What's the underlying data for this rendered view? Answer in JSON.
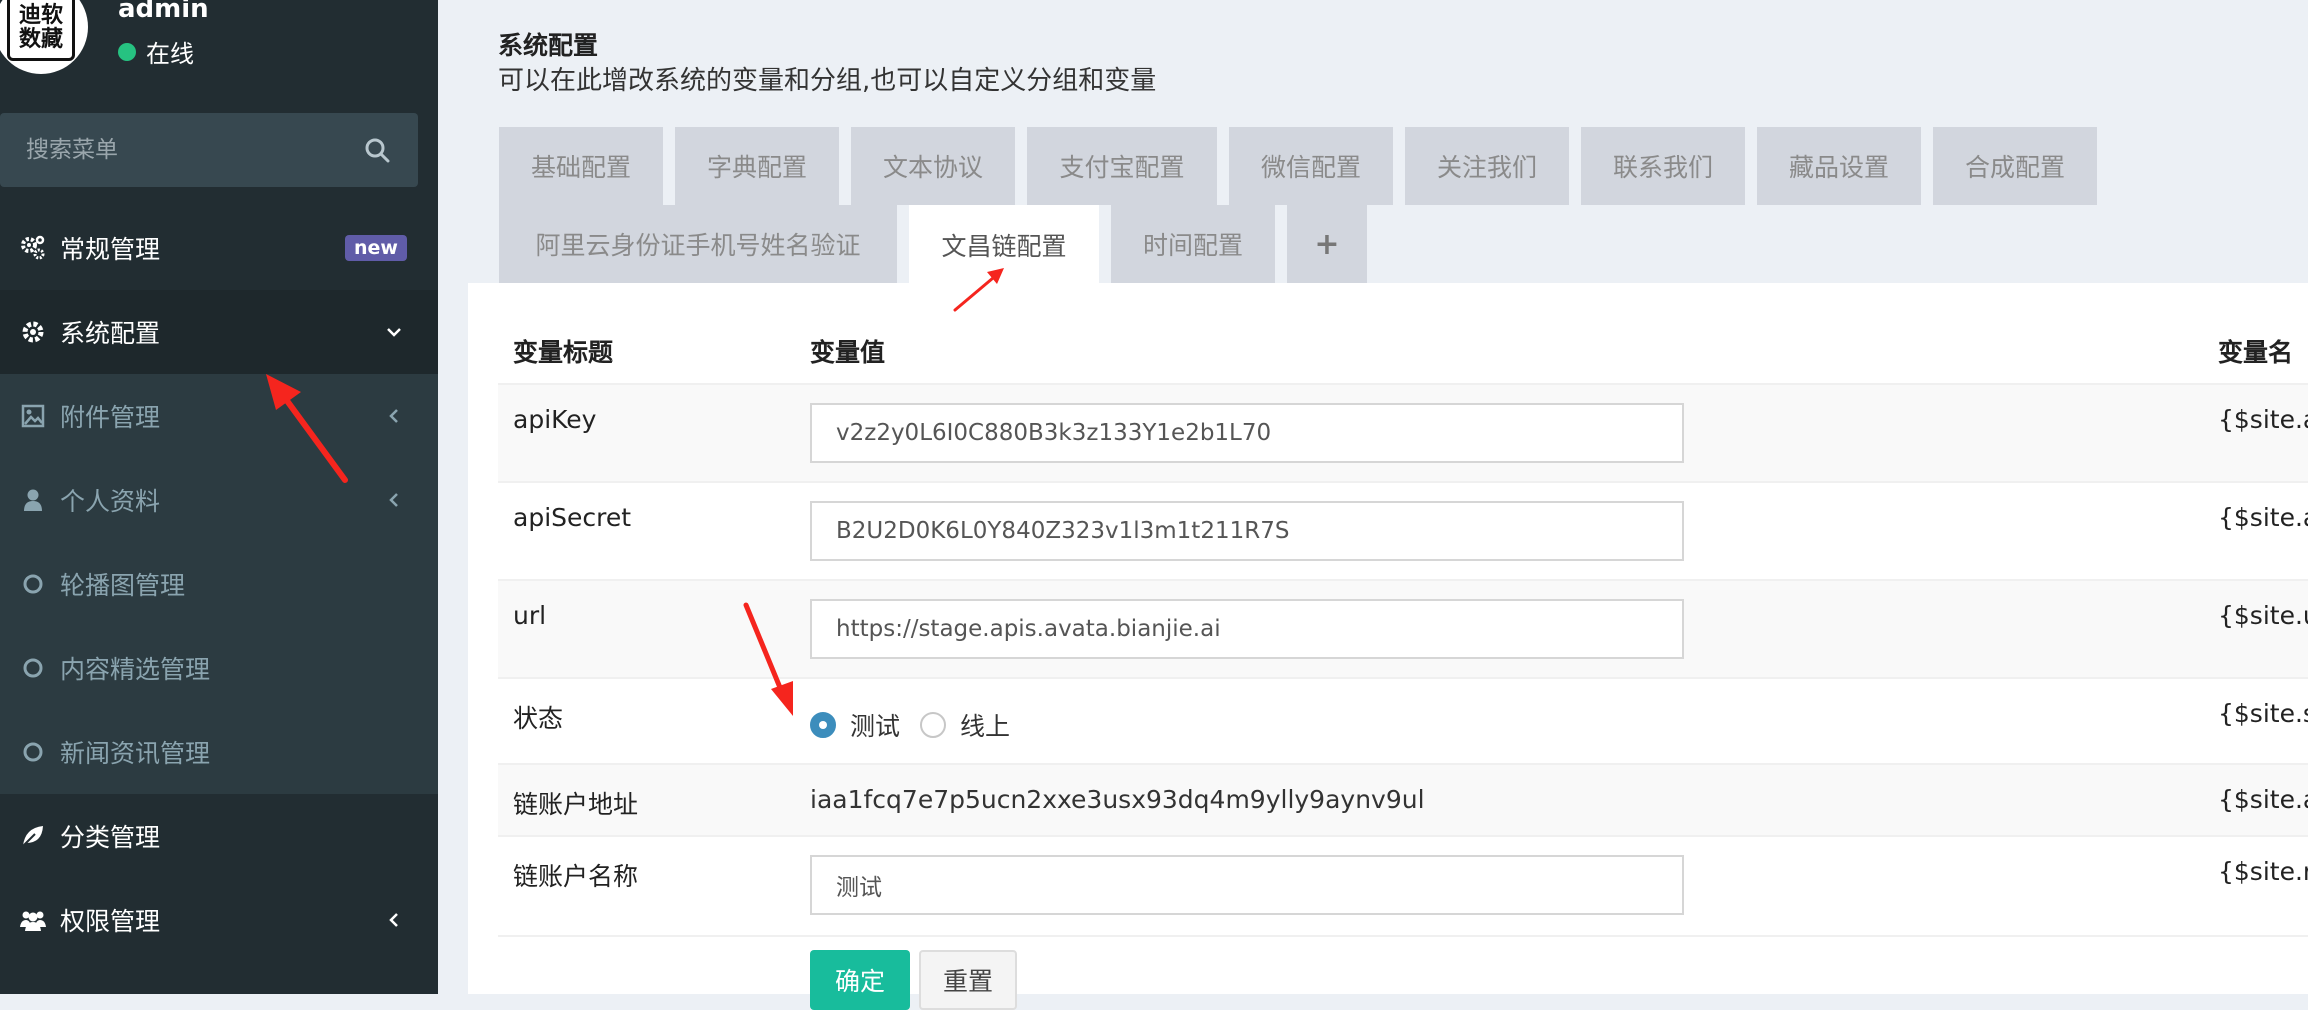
{
  "user": {
    "avatar_text_1": "迪软",
    "avatar_text_2": "数藏",
    "name": "admin",
    "status": "在线"
  },
  "search": {
    "placeholder": "搜索菜单"
  },
  "menu": {
    "items": [
      {
        "label": "常规管理",
        "badge": "new",
        "icon": "gears-icon"
      },
      {
        "label": "系统配置",
        "icon": "gear-icon",
        "chevron": "down"
      },
      {
        "label": "附件管理",
        "icon": "image-icon",
        "chevron": "left"
      },
      {
        "label": "个人资料",
        "icon": "user-icon",
        "chevron": "left"
      },
      {
        "label": "轮播图管理",
        "icon": "circle-icon"
      },
      {
        "label": "内容精选管理",
        "icon": "circle-icon"
      },
      {
        "label": "新闻资讯管理",
        "icon": "circle-icon"
      },
      {
        "label": "分类管理",
        "icon": "leaf-icon"
      },
      {
        "label": "权限管理",
        "icon": "users-icon",
        "chevron": "left"
      }
    ]
  },
  "page": {
    "title": "系统配置",
    "description": "可以在此增改系统的变量和分组,也可以自定义分组和变量"
  },
  "tabs": [
    "基础配置",
    "字典配置",
    "文本协议",
    "支付宝配置",
    "微信配置",
    "关注我们",
    "联系我们",
    "藏品设置",
    "合成配置",
    "阿里云身份证手机号姓名验证",
    "文昌链配置",
    "时间配置",
    "+"
  ],
  "active_tab": "文昌链配置",
  "table": {
    "headers": {
      "title": "变量标题",
      "value": "变量值",
      "name": "变量名"
    },
    "rows": [
      {
        "title": "apiKey",
        "value": "v2z2y0L6I0C880B3k3z133Y1e2b1L70",
        "var": "{$site.apiKey"
      },
      {
        "title": "apiSecret",
        "value": "B2U2D0K6L0Y840Z323v1l3m1t211R7S",
        "var": "{$site.apiSec"
      },
      {
        "title": "url",
        "value": "https://stage.apis.avata.bianjie.ai",
        "var": "{$site.url}"
      },
      {
        "title": "状态",
        "radio_test": "测试",
        "radio_online": "线上",
        "selected": "测试",
        "var": "{$site.status}"
      },
      {
        "title": "链账户地址",
        "value": "iaa1fcq7e7p5ucn2xxe3usx93dq4m9ylly9aynv9ul",
        "var": "{$site.accour"
      },
      {
        "title": "链账户名称",
        "value": "测试",
        "var": "{$site.names}"
      }
    ]
  },
  "buttons": {
    "ok": "确定",
    "reset": "重置"
  },
  "colors": {
    "sidebar": "#222d32",
    "accent_green": "#18bc9c",
    "badge_purple": "#605ca8",
    "arrow_red": "#f5251e",
    "radio_blue": "#3c8dbc"
  }
}
